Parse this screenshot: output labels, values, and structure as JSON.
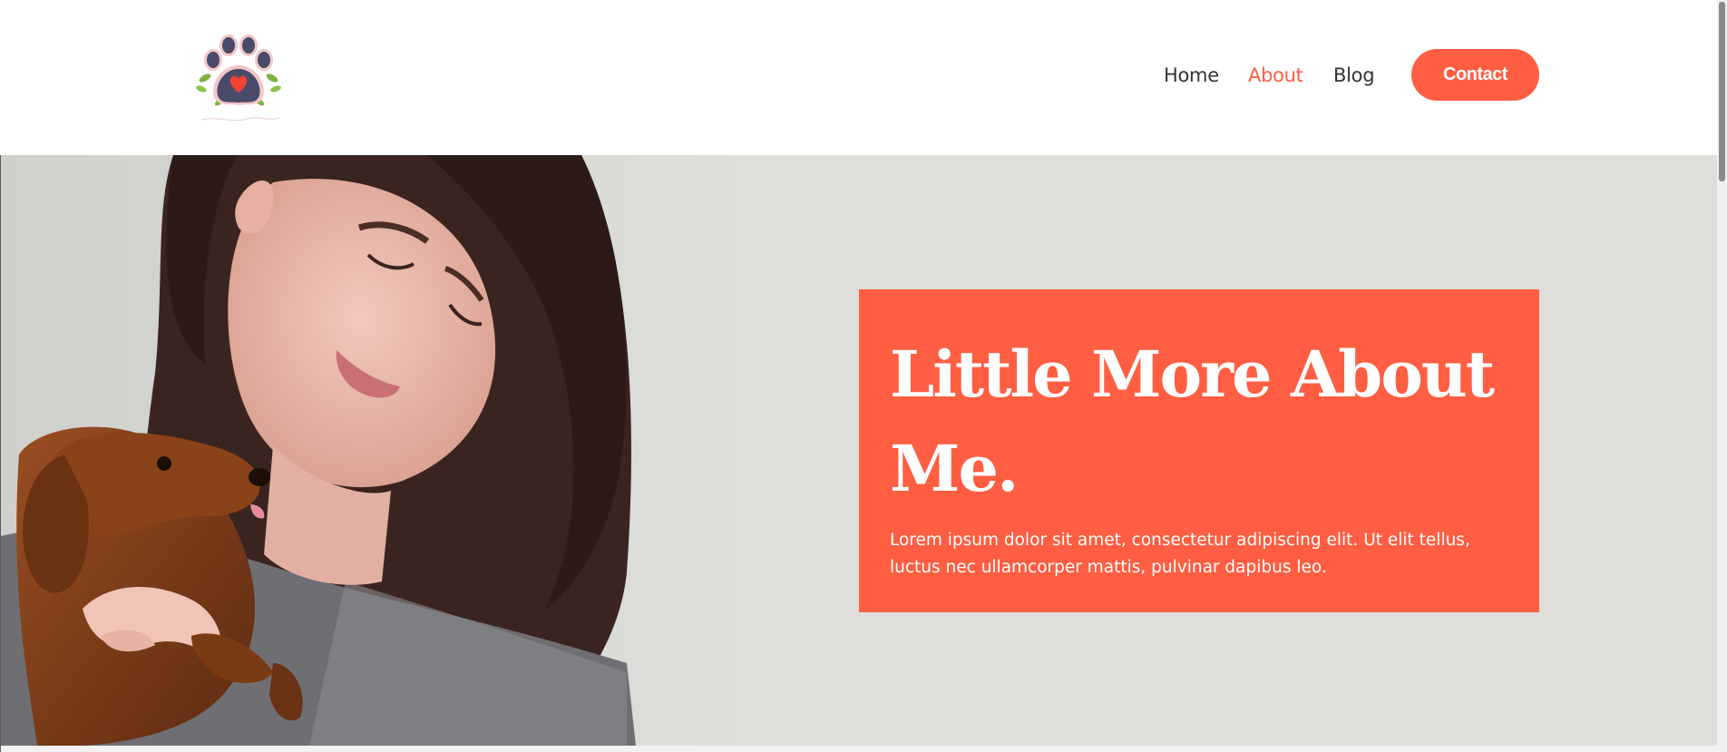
{
  "brand": {
    "logo_icon": "paw-heart-logo",
    "accent_color": "#ff5e42"
  },
  "nav": {
    "items": [
      {
        "label": "Home",
        "active": false
      },
      {
        "label": "About",
        "active": true
      },
      {
        "label": "Blog",
        "active": false
      }
    ],
    "contact_label": "Contact"
  },
  "hero": {
    "title": "Little More About Me.",
    "text": "Lorem ipsum dolor sit amet, consectetur adipiscing elit. Ut elit tellus, luctus nec ullamcorper mattis, pulvinar dapibus leo.",
    "image": "woman-hugging-dachshund-photo",
    "background_color": "#dededa",
    "card_color": "#ff5e42"
  }
}
